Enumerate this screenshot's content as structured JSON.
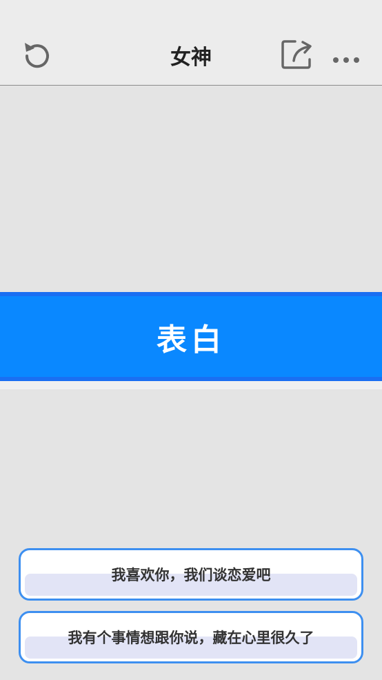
{
  "header": {
    "title": "女神",
    "left_icon": "reload-icon",
    "right_icons": [
      "share-icon",
      "more-icon"
    ]
  },
  "main": {
    "confess_label": "表白",
    "accent_color": "#0a88ff"
  },
  "options": [
    {
      "label": "我喜欢你，我们谈恋爱吧"
    },
    {
      "label": "我有个事情想跟你说，藏在心里很久了"
    }
  ]
}
